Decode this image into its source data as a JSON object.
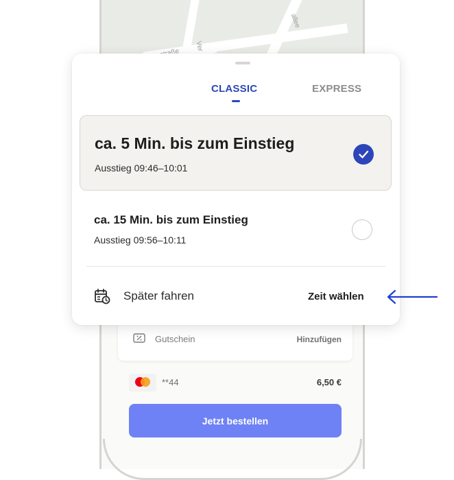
{
  "map": {
    "street_labels": [
      "straße",
      "Ver",
      "allee"
    ]
  },
  "ride_sheet": {
    "tabs": [
      {
        "label": "CLASSIC",
        "active": true
      },
      {
        "label": "EXPRESS",
        "active": false
      }
    ],
    "options": [
      {
        "title": "ca. 5 Min. bis zum Einstieg",
        "subtitle": "Ausstieg 09:46–10:01",
        "selected": true
      },
      {
        "title": "ca. 15 Min. bis zum Einstieg",
        "subtitle": "Ausstieg 09:56–10:11",
        "selected": false
      }
    ],
    "schedule": {
      "label": "Später fahren",
      "action_label": "Zeit wählen",
      "icon": "calendar-clock-icon"
    }
  },
  "voucher": {
    "label": "Gutschein",
    "action_label": "Hinzufügen",
    "icon": "voucher-icon"
  },
  "payment": {
    "card_label": "**44",
    "price": "6,50 €",
    "icon": "mastercard-icon"
  },
  "order_button": {
    "label": "Jetzt bestellen"
  },
  "colors": {
    "accent": "#2c46b9",
    "order_button": "#6e82f5",
    "annotation_arrow": "#1f3fd1"
  }
}
